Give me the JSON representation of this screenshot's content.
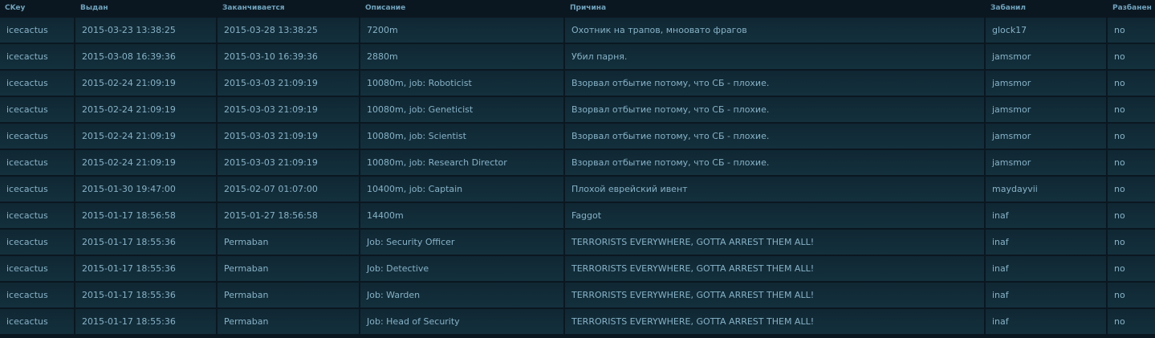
{
  "table": {
    "headers": [
      "CKey",
      "Выдан",
      "Заканчивается",
      "Описание",
      "Причина",
      "Забанил",
      "Разбанен"
    ],
    "rows": [
      [
        "icecactus",
        "2015-03-23 13:38:25",
        "2015-03-28 13:38:25",
        "7200m",
        "Охотник на трапов, мноовато фрагов",
        "glock17",
        "no"
      ],
      [
        "icecactus",
        "2015-03-08 16:39:36",
        "2015-03-10 16:39:36",
        "2880m",
        "Убил парня.",
        "jamsmor",
        "no"
      ],
      [
        "icecactus",
        "2015-02-24 21:09:19",
        "2015-03-03 21:09:19",
        "10080m, job: Roboticist",
        "Взорвал отбытие потому, что СБ - плохие.",
        "jamsmor",
        "no"
      ],
      [
        "icecactus",
        "2015-02-24 21:09:19",
        "2015-03-03 21:09:19",
        "10080m, job: Geneticist",
        "Взорвал отбытие потому, что СБ - плохие.",
        "jamsmor",
        "no"
      ],
      [
        "icecactus",
        "2015-02-24 21:09:19",
        "2015-03-03 21:09:19",
        "10080m, job: Scientist",
        "Взорвал отбытие потому, что СБ - плохие.",
        "jamsmor",
        "no"
      ],
      [
        "icecactus",
        "2015-02-24 21:09:19",
        "2015-03-03 21:09:19",
        "10080m, job: Research Director",
        "Взорвал отбытие потому, что СБ - плохие.",
        "jamsmor",
        "no"
      ],
      [
        "icecactus",
        "2015-01-30 19:47:00",
        "2015-02-07 01:07:00",
        "10400m, job: Captain",
        "Плохой еврейский ивент",
        "maydayvii",
        "no"
      ],
      [
        "icecactus",
        "2015-01-17 18:56:58",
        "2015-01-27 18:56:58",
        "14400m",
        "Faggot",
        "inaf",
        "no"
      ],
      [
        "icecactus",
        "2015-01-17 18:55:36",
        "Permaban",
        "Job: Security Officer",
        "TERRORISTS EVERYWHERE, GOTTA ARREST THEM ALL!",
        "inaf",
        "no"
      ],
      [
        "icecactus",
        "2015-01-17 18:55:36",
        "Permaban",
        "Job: Detective",
        "TERRORISTS EVERYWHERE, GOTTA ARREST THEM ALL!",
        "inaf",
        "no"
      ],
      [
        "icecactus",
        "2015-01-17 18:55:36",
        "Permaban",
        "Job: Warden",
        "TERRORISTS EVERYWHERE, GOTTA ARREST THEM ALL!",
        "inaf",
        "no"
      ],
      [
        "icecactus",
        "2015-01-17 18:55:36",
        "Permaban",
        "Job: Head of Security",
        "TERRORISTS EVERYWHERE, GOTTA ARREST THEM ALL!",
        "inaf",
        "no"
      ]
    ]
  }
}
